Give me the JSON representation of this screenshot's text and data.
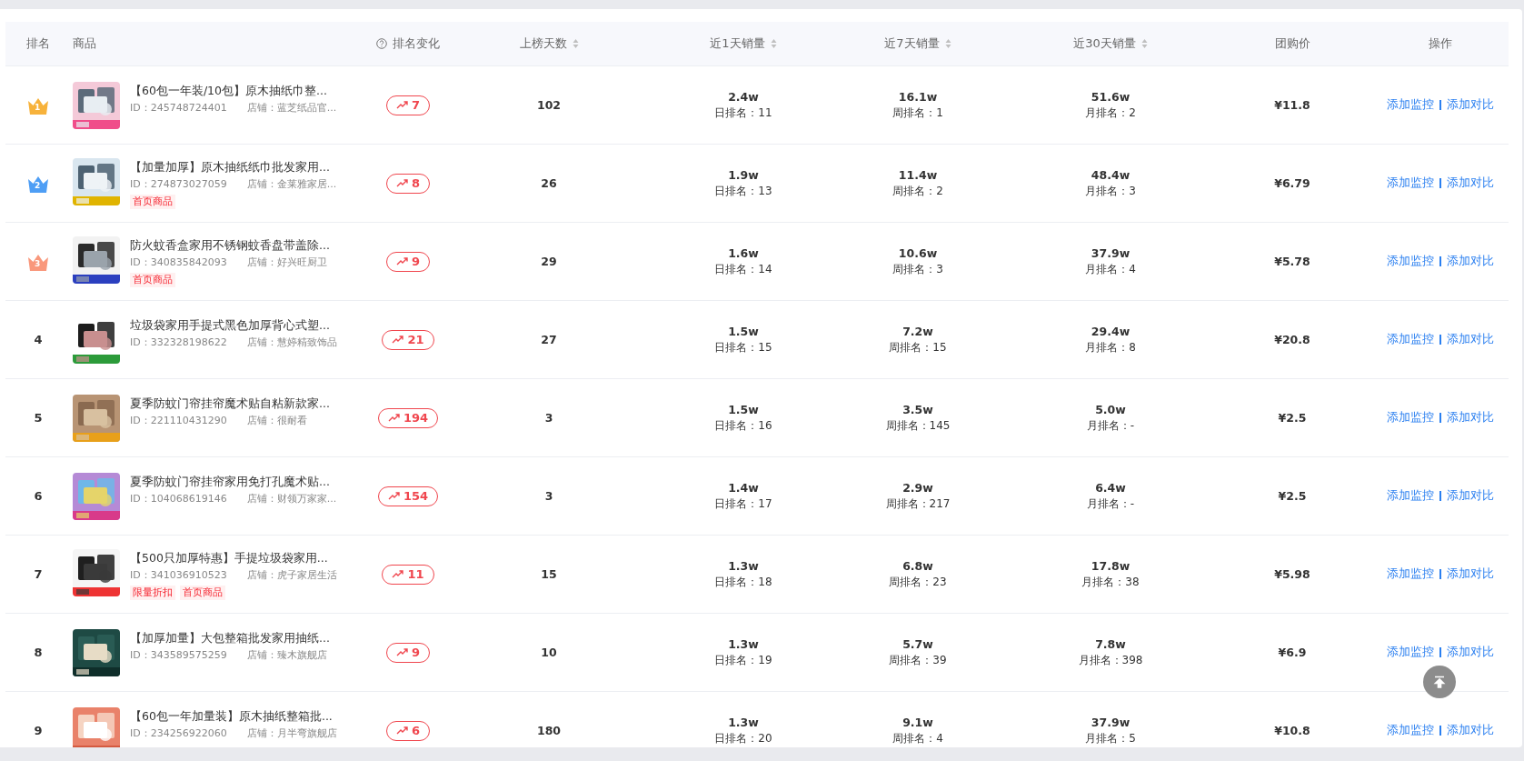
{
  "columns": [
    {
      "label": "排名",
      "sortable": false,
      "help": false
    },
    {
      "label": "商品",
      "sortable": false,
      "help": false
    },
    {
      "label": "排名变化",
      "sortable": false,
      "help": true
    },
    {
      "label": "上榜天数",
      "sortable": true,
      "help": false
    },
    {
      "label": "近1天销量",
      "sortable": true,
      "help": false
    },
    {
      "label": "近7天销量",
      "sortable": true,
      "help": false
    },
    {
      "label": "近30天销量",
      "sortable": true,
      "help": false
    },
    {
      "label": "团购价",
      "sortable": false,
      "help": false
    },
    {
      "label": "操作",
      "sortable": false,
      "help": false
    }
  ],
  "rows": [
    {
      "rank": "1",
      "kind": "crown",
      "color": "#f7b23b",
      "title": "【60包一年装/10包】原木抽纸巾整...",
      "id": "ID：245748724401",
      "shop": "店铺：蓝芝纸品官...",
      "tags": [],
      "change": "7",
      "days": "102",
      "day": {
        "sales": "2.4w",
        "rank": "日排名：11"
      },
      "week": {
        "sales": "16.1w",
        "rank": "周排名：1"
      },
      "month": {
        "sales": "51.6w",
        "rank": "月排名：2"
      },
      "price": "¥11.8",
      "actions": [
        "添加监控",
        "添加对比"
      ]
    },
    {
      "rank": "2",
      "kind": "crown",
      "color": "#4e9ef5",
      "title": "【加量加厚】原木抽纸纸巾批发家用...",
      "id": "ID：274873027059",
      "shop": "店铺：金莱雅家居...",
      "tags": [
        "首页商品"
      ],
      "change": "8",
      "days": "26",
      "day": {
        "sales": "1.9w",
        "rank": "日排名：13"
      },
      "week": {
        "sales": "11.4w",
        "rank": "周排名：2"
      },
      "month": {
        "sales": "48.4w",
        "rank": "月排名：3"
      },
      "price": "¥6.79",
      "actions": [
        "添加监控",
        "添加对比"
      ]
    },
    {
      "rank": "3",
      "kind": "crown",
      "color": "#f9987c",
      "title": "防火蚊香盒家用不锈钢蚊香盘带盖除...",
      "id": "ID：340835842093",
      "shop": "店铺：好兴旺厨卫",
      "tags": [
        "首页商品"
      ],
      "change": "9",
      "days": "29",
      "day": {
        "sales": "1.6w",
        "rank": "日排名：14"
      },
      "week": {
        "sales": "10.6w",
        "rank": "周排名：3"
      },
      "month": {
        "sales": "37.9w",
        "rank": "月排名：4"
      },
      "price": "¥5.78",
      "actions": [
        "添加监控",
        "添加对比"
      ]
    },
    {
      "rank": "4",
      "kind": "plain",
      "title": "垃圾袋家用手提式黑色加厚背心式塑...",
      "id": "ID：332328198622",
      "shop": "店铺：慧婷精致饰品",
      "tags": [],
      "change": "21",
      "days": "27",
      "day": {
        "sales": "1.5w",
        "rank": "日排名：15"
      },
      "week": {
        "sales": "7.2w",
        "rank": "周排名：15"
      },
      "month": {
        "sales": "29.4w",
        "rank": "月排名：8"
      },
      "price": "¥20.8",
      "actions": [
        "添加监控",
        "添加对比"
      ]
    },
    {
      "rank": "5",
      "kind": "plain",
      "title": "夏季防蚊门帘挂帘魔术贴自粘新款家...",
      "id": "ID：221110431290",
      "shop": "店铺：很耐看",
      "tags": [],
      "change": "194",
      "days": "3",
      "day": {
        "sales": "1.5w",
        "rank": "日排名：16"
      },
      "week": {
        "sales": "3.5w",
        "rank": "周排名：145"
      },
      "month": {
        "sales": "5.0w",
        "rank": "月排名：-"
      },
      "price": "¥2.5",
      "actions": [
        "添加监控",
        "添加对比"
      ]
    },
    {
      "rank": "6",
      "kind": "plain",
      "title": "夏季防蚊门帘挂帘家用免打孔魔术贴...",
      "id": "ID：104068619146",
      "shop": "店铺：财领万家家...",
      "tags": [],
      "change": "154",
      "days": "3",
      "day": {
        "sales": "1.4w",
        "rank": "日排名：17"
      },
      "week": {
        "sales": "2.9w",
        "rank": "周排名：217"
      },
      "month": {
        "sales": "6.4w",
        "rank": "月排名：-"
      },
      "price": "¥2.5",
      "actions": [
        "添加监控",
        "添加对比"
      ]
    },
    {
      "rank": "7",
      "kind": "plain",
      "title": "【500只加厚特惠】手提垃圾袋家用...",
      "id": "ID：341036910523",
      "shop": "店铺：虎子家居生活",
      "tags": [
        "限量折扣",
        "首页商品"
      ],
      "change": "11",
      "days": "15",
      "day": {
        "sales": "1.3w",
        "rank": "日排名：18"
      },
      "week": {
        "sales": "6.8w",
        "rank": "周排名：23"
      },
      "month": {
        "sales": "17.8w",
        "rank": "月排名：38"
      },
      "price": "¥5.98",
      "actions": [
        "添加监控",
        "添加对比"
      ]
    },
    {
      "rank": "8",
      "kind": "plain",
      "title": "【加厚加量】大包整箱批发家用抽纸...",
      "id": "ID：343589575259",
      "shop": "店铺：臻木旗舰店",
      "tags": [],
      "change": "9",
      "days": "10",
      "day": {
        "sales": "1.3w",
        "rank": "日排名：19"
      },
      "week": {
        "sales": "5.7w",
        "rank": "周排名：39"
      },
      "month": {
        "sales": "7.8w",
        "rank": "月排名：398"
      },
      "price": "¥6.9",
      "actions": [
        "添加监控",
        "添加对比"
      ]
    },
    {
      "rank": "9",
      "kind": "plain",
      "title": "【60包一年加量装】原木抽纸整箱批...",
      "id": "ID：234256922060",
      "shop": "店铺：月半弯旗舰店",
      "tags": [],
      "change": "6",
      "days": "180",
      "day": {
        "sales": "1.3w",
        "rank": "日排名：20"
      },
      "week": {
        "sales": "9.1w",
        "rank": "周排名：4"
      },
      "month": {
        "sales": "37.9w",
        "rank": "月排名：5"
      },
      "price": "¥10.8",
      "actions": [
        "添加监控",
        "添加对比"
      ]
    }
  ]
}
